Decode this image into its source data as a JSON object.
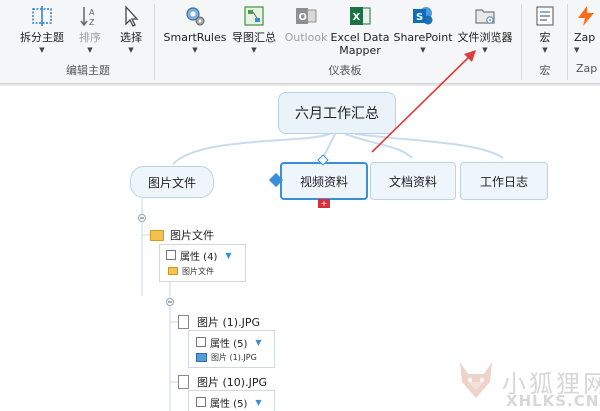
{
  "ribbon": {
    "edit_group": {
      "label": "编辑主题",
      "split_label": "拆分主题",
      "sort_label": "排序",
      "select_label": "选择"
    },
    "dashboard_group": {
      "label": "仪表板",
      "smartrules_label": "SmartRules",
      "map_summary_label": "导图汇总",
      "outlook_label": "Outlook",
      "excel_label_1": "Excel Data",
      "excel_label_2": "Mapper",
      "sharepoint_label": "SharePoint",
      "file_browser_label": "文件浏览器"
    },
    "macro_group": {
      "label": "宏",
      "macro_label": "宏"
    },
    "zap_group": {
      "label": "Zap",
      "zap_label": "Zap"
    }
  },
  "canvas": {
    "central_topic": "六月工作汇总",
    "topics": {
      "pictures": "图片文件",
      "video": "视频资料",
      "docs": "文档资料",
      "worklog": "工作日志"
    },
    "folder_item": {
      "name": "图片文件",
      "properties": "属性 (4)",
      "sub_name": "图片文件"
    },
    "file_1": {
      "name": "图片 (1).JPG",
      "properties": "属性 (5)",
      "sub_name": "图片 (1).JPG"
    },
    "file_10": {
      "name": "图片 (10).JPG",
      "properties": "属性 (5)"
    }
  },
  "watermark": {
    "cn": "小狐狸网",
    "en": "XHLKS.CN"
  },
  "colors": {
    "accent": "#3b8fd9",
    "arrow": "#e23b3b",
    "excel_green": "#1e7145",
    "sharepoint_blue": "#0a6ebd",
    "outlook_gray": "#8f8f8f"
  }
}
